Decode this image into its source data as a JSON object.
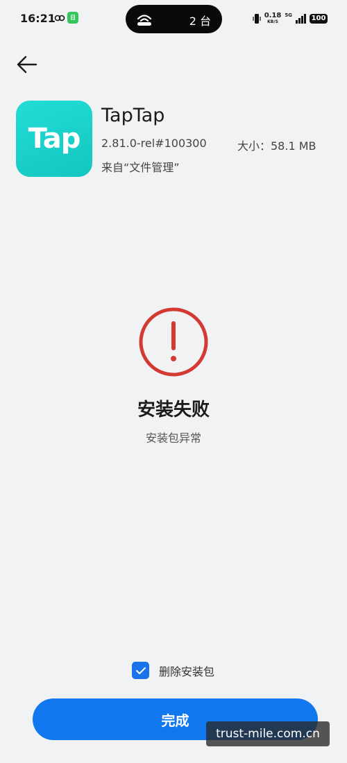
{
  "status_bar": {
    "time": "16:21",
    "app_badge": "日",
    "island_count": "2 台",
    "speed_value": "0.18",
    "speed_unit": "KB/S",
    "network": "5G",
    "battery": "100"
  },
  "header": {
    "back_icon": "arrow-left-icon"
  },
  "app": {
    "icon_text": "Tap",
    "icon_color": "#1fd2cc",
    "name": "TapTap",
    "version": "2.81.0-rel#100300",
    "size": "大小：58.1 MB",
    "source": "来自“文件管理”"
  },
  "result": {
    "icon": "exclamation-circle-icon",
    "icon_color": "#d33a32",
    "title": "安装失败",
    "reason": "安装包异常"
  },
  "options": {
    "delete_package_label": "删除安装包",
    "delete_package_checked": true
  },
  "actions": {
    "done_label": "完成",
    "accent_color": "#1177ef"
  },
  "watermark": "trust-mile.com.cn"
}
